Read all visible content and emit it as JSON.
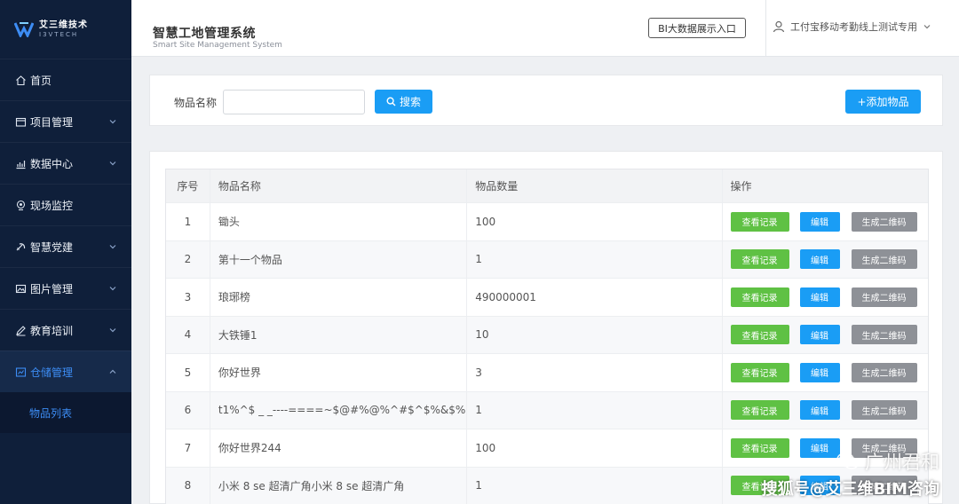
{
  "brand": {
    "name_cn": "艾三维技术",
    "name_en": "I3VTECH"
  },
  "sidebar": {
    "items": [
      {
        "label": "首页",
        "icon": "home-icon",
        "expandable": false
      },
      {
        "label": "项目管理",
        "icon": "folder-icon",
        "expandable": true
      },
      {
        "label": "数据中心",
        "icon": "chart-icon",
        "expandable": true
      },
      {
        "label": "现场监控",
        "icon": "camera-icon",
        "expandable": false
      },
      {
        "label": "智慧党建",
        "icon": "party-icon",
        "expandable": true
      },
      {
        "label": "图片管理",
        "icon": "image-icon",
        "expandable": true
      },
      {
        "label": "教育培训",
        "icon": "pen-icon",
        "expandable": true
      },
      {
        "label": "仓储管理",
        "icon": "warehouse-icon",
        "expandable": true,
        "active": true
      }
    ],
    "sub_item": "物品列表"
  },
  "header": {
    "title": "智慧工地管理系统",
    "subtitle": "Smart Site Management System",
    "bi_button": "BI大数据展示入口",
    "user": "工付宝移动考勤线上测试专用"
  },
  "search": {
    "label": "物品名称",
    "value": "",
    "button": "搜索",
    "add_button": "+添加物品"
  },
  "table": {
    "columns": [
      "序号",
      "物品名称",
      "物品数量",
      "操作"
    ],
    "actions": {
      "view": "查看记录",
      "edit": "编辑",
      "qr": "生成二维码"
    },
    "rows": [
      {
        "idx": "1",
        "name": "锄头",
        "qty": "100"
      },
      {
        "idx": "2",
        "name": "第十一个物品",
        "qty": "1"
      },
      {
        "idx": "3",
        "name": "琅琊榜",
        "qty": "490000001"
      },
      {
        "idx": "4",
        "name": "大铁锤1",
        "qty": "10"
      },
      {
        "idx": "5",
        "name": "你好世界",
        "qty": "3"
      },
      {
        "idx": "6",
        "name": "t1%^$ _ _----====~$@#%@%^#$^$%&$%",
        "qty": "1"
      },
      {
        "idx": "7",
        "name": "你好世界244",
        "qty": "100"
      },
      {
        "idx": "8",
        "name": "小米 8 se 超清广角小米 8 se 超清广角",
        "qty": "1"
      }
    ]
  },
  "watermark": {
    "line1": "广州君和",
    "line2": "搜狐号@艾三维BIM咨询"
  },
  "colors": {
    "sidebar_bg": "#0f1f3a",
    "accent": "#1a9df5",
    "view_green": "#5fc144",
    "qr_gray": "#8e9197",
    "active_text": "#3d8df5"
  }
}
